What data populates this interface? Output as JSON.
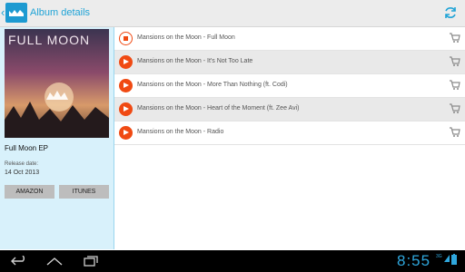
{
  "header": {
    "title": "Album details",
    "back_icon": "chevron-left-icon",
    "app_icon": "moon-logo-icon",
    "refresh_icon": "refresh-icon",
    "accent": "#1fa3d6"
  },
  "album": {
    "cover_text": "FULL MOON",
    "name": "Full Moon EP",
    "release_label": "Release date:",
    "release_date": "14 Oct  2013",
    "buttons": [
      "AMAZON",
      "ITUNES"
    ]
  },
  "tracks": [
    {
      "title": "Mansions on the Moon - Full Moon",
      "state": "playing"
    },
    {
      "title": "Mansions on the Moon - It's Not Too Late",
      "state": "stopped"
    },
    {
      "title": "Mansions on the Moon - More Than Nothing (ft. Codi)",
      "state": "stopped"
    },
    {
      "title": "Mansions on the Moon - Heart of the Moment (ft. Zee Avi)",
      "state": "stopped"
    },
    {
      "title": "Mansions on the Moon - Radio",
      "state": "stopped"
    }
  ],
  "system_bar": {
    "time": "8:55",
    "network": "3G",
    "back_icon": "back-icon",
    "home_icon": "home-icon",
    "recents_icon": "recents-icon",
    "battery_icon": "battery-icon"
  },
  "colors": {
    "play": "#f04a13",
    "sidebar_bg": "#d8f1fb"
  }
}
